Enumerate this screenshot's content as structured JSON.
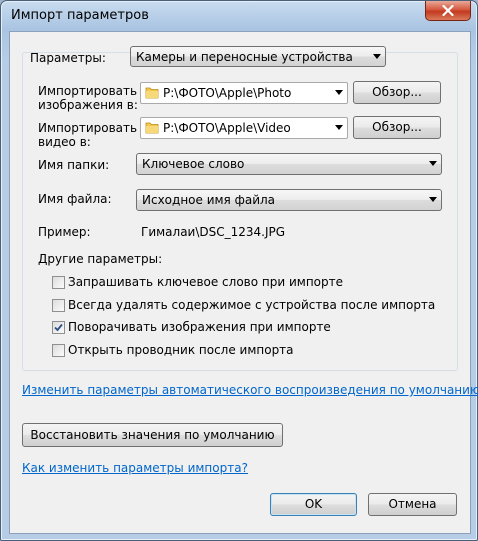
{
  "window": {
    "title": "Импорт параметров"
  },
  "settings": {
    "label": "Параметры:",
    "selected": "Камеры и переносные устройства"
  },
  "import_images": {
    "label_line1": "Импортировать",
    "label_line2": "изображения в:",
    "path": "P:\\ФОТО\\Apple\\Photo",
    "browse": "Обзор..."
  },
  "import_video": {
    "label_line1": "Импортировать",
    "label_line2": "видео в:",
    "path": "P:\\ФОТО\\Apple\\Video",
    "browse": "Обзор..."
  },
  "folder_name": {
    "label": "Имя папки:",
    "selected": "Ключевое слово"
  },
  "file_name": {
    "label": "Имя файла:",
    "selected": "Исходное имя файла"
  },
  "example": {
    "label": "Пример:",
    "value": "Гималаи\\DSC_1234.JPG"
  },
  "other": {
    "heading": "Другие параметры:",
    "options": [
      {
        "label": "Запрашивать ключевое слово при импорте",
        "checked": false
      },
      {
        "label": "Всегда удалять содержимое с устройства после импорта",
        "checked": false
      },
      {
        "label": "Поворачивать изображения при импорте",
        "checked": true
      },
      {
        "label": "Открыть проводник после импорта",
        "checked": false
      }
    ]
  },
  "links": {
    "autoplay": "Изменить параметры автоматического воспроизведения по умолчанию",
    "howto": "Как изменить параметры импорта?"
  },
  "buttons": {
    "restore": "Восстановить значения по умолчанию",
    "ok": "OK",
    "cancel": "Отмена"
  }
}
